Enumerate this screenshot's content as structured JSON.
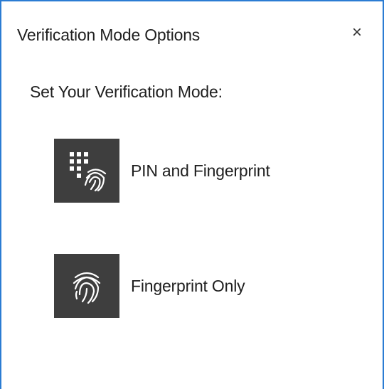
{
  "dialog": {
    "title": "Verification Mode Options",
    "close_glyph": "×",
    "prompt": "Set Your Verification Mode:",
    "accent_color": "#2b7cd3",
    "tile_color": "#3e3e3e"
  },
  "options": [
    {
      "label": "PIN and Fingerprint",
      "icon": "pin-fingerprint-icon"
    },
    {
      "label": "Fingerprint Only",
      "icon": "fingerprint-icon"
    }
  ]
}
